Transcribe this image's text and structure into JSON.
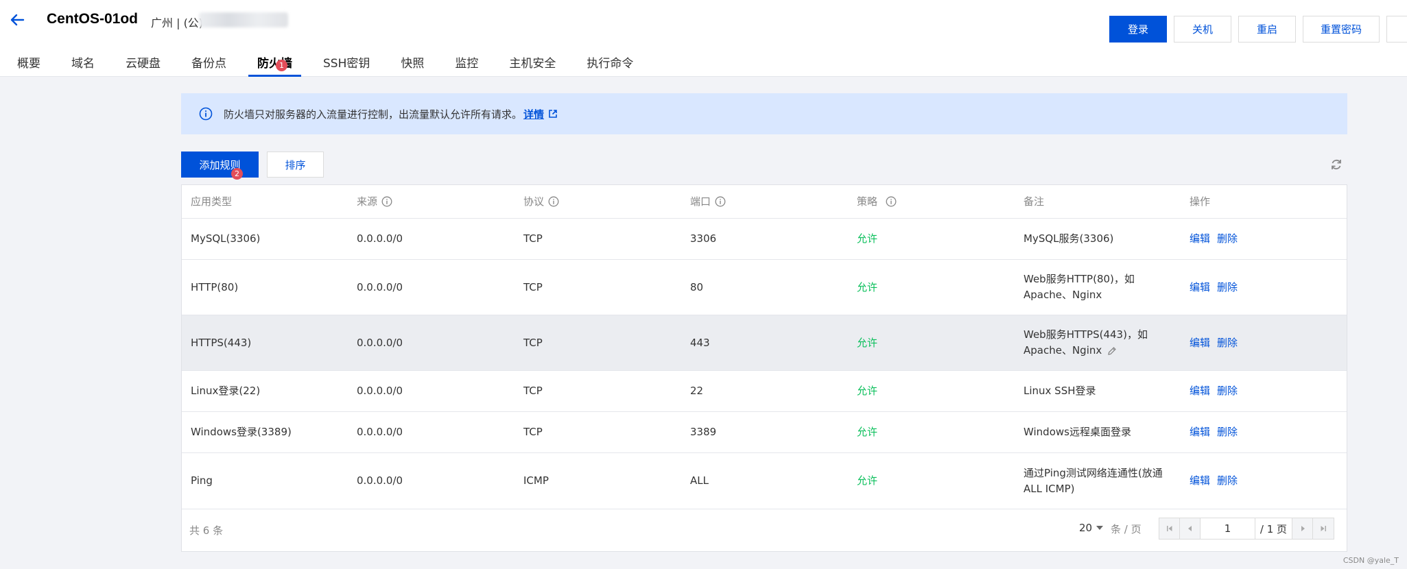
{
  "header": {
    "instance_name": "CentOS-01od",
    "region": "广州 | (公)",
    "actions": {
      "login": "登录",
      "shutdown": "关机",
      "restart": "重启",
      "reset_password": "重置密码"
    }
  },
  "tabs": [
    {
      "label": "概要"
    },
    {
      "label": "域名"
    },
    {
      "label": "云硬盘"
    },
    {
      "label": "备份点"
    },
    {
      "label": "防火墙",
      "active": true,
      "badge": "1"
    },
    {
      "label": "SSH密钥"
    },
    {
      "label": "快照"
    },
    {
      "label": "监控"
    },
    {
      "label": "主机安全"
    },
    {
      "label": "执行命令"
    }
  ],
  "banner": {
    "text": "防火墙只对服务器的入流量进行控制，出流量默认允许所有请求。",
    "link": "详情"
  },
  "toolbar": {
    "add_rule": "添加规则",
    "add_rule_badge": "2",
    "sort": "排序"
  },
  "table": {
    "headers": {
      "app_type": "应用类型",
      "source": "来源",
      "protocol": "协议",
      "port": "端口",
      "policy": "策略",
      "remark": "备注",
      "action": "操作"
    },
    "actions": {
      "edit": "编辑",
      "delete": "删除"
    },
    "rows": [
      {
        "app": "MySQL(3306)",
        "source": "0.0.0.0/0",
        "protocol": "TCP",
        "port": "3306",
        "policy": "允许",
        "remark1": "MySQL服务(3306)",
        "remark2": ""
      },
      {
        "app": "HTTP(80)",
        "source": "0.0.0.0/0",
        "protocol": "TCP",
        "port": "80",
        "policy": "允许",
        "remark1": "Web服务HTTP(80)，如",
        "remark2": "Apache、Nginx"
      },
      {
        "app": "HTTPS(443)",
        "source": "0.0.0.0/0",
        "protocol": "TCP",
        "port": "443",
        "policy": "允许",
        "remark1": "Web服务HTTPS(443)，如",
        "remark2": "Apache、Nginx"
      },
      {
        "app": "Linux登录(22)",
        "source": "0.0.0.0/0",
        "protocol": "TCP",
        "port": "22",
        "policy": "允许",
        "remark1": "Linux SSH登录",
        "remark2": ""
      },
      {
        "app": "Windows登录(3389)",
        "source": "0.0.0.0/0",
        "protocol": "TCP",
        "port": "3389",
        "policy": "允许",
        "remark1": "Windows远程桌面登录",
        "remark2": ""
      },
      {
        "app": "Ping",
        "source": "0.0.0.0/0",
        "protocol": "ICMP",
        "port": "ALL",
        "policy": "允许",
        "remark1": "通过Ping测试网络连通性(放通",
        "remark2": "ALL ICMP)"
      }
    ]
  },
  "footer": {
    "total": "共 6 条",
    "page_size": "20",
    "per_page": "条 / 页",
    "current_page": "1",
    "total_pages": "/ 1 页"
  },
  "watermark": "CSDN @yale_T"
}
